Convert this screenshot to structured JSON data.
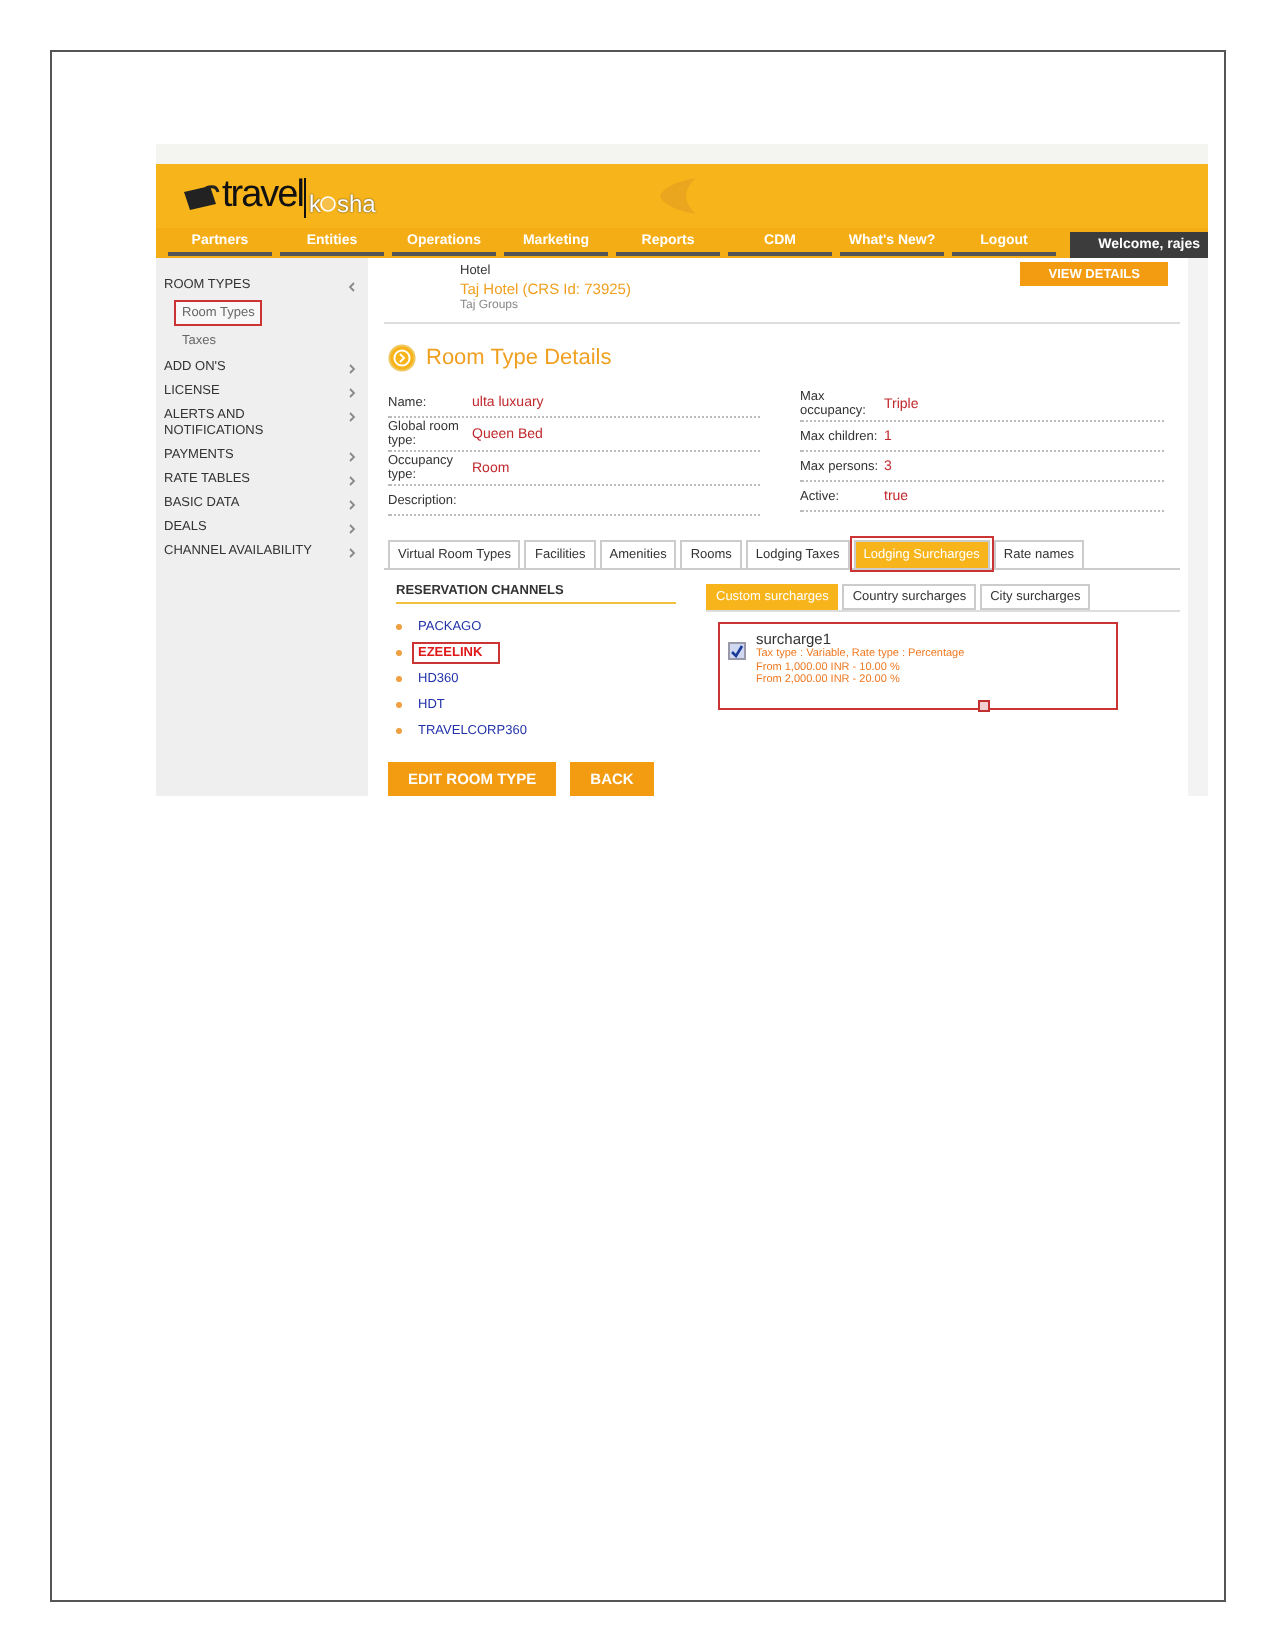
{
  "header": {
    "logo": {
      "first": "travel",
      "second": "k",
      "third": "sha"
    },
    "nav": [
      {
        "label": "Partners"
      },
      {
        "label": "Entities"
      },
      {
        "label": "Operations"
      },
      {
        "label": "Marketing"
      },
      {
        "label": "Reports"
      },
      {
        "label": "CDM"
      },
      {
        "label": "What's New?"
      },
      {
        "label": "Logout"
      }
    ],
    "welcome": "Welcome, rajes"
  },
  "sidebar": {
    "items": [
      {
        "label": "ROOM TYPES",
        "expanded": true,
        "children": [
          {
            "label": "Room Types",
            "selected": true
          },
          {
            "label": "Taxes",
            "selected": false
          }
        ]
      },
      {
        "label": "ADD ON'S",
        "expanded": false
      },
      {
        "label": "LICENSE",
        "expanded": false
      },
      {
        "label": "ALERTS AND NOTIFICATIONS",
        "expanded": false
      },
      {
        "label": "PAYMENTS",
        "expanded": false
      },
      {
        "label": "RATE TABLES",
        "expanded": false
      },
      {
        "label": "BASIC DATA",
        "expanded": false
      },
      {
        "label": "DEALS",
        "expanded": false
      },
      {
        "label": "CHANNEL AVAILABILITY",
        "expanded": false
      }
    ]
  },
  "hotel": {
    "label": "Hotel",
    "name": "Taj Hotel (CRS Id: 73925)",
    "group": "Taj Groups",
    "button": "VIEW DETAILS"
  },
  "details": {
    "title": "Room Type Details",
    "left": [
      {
        "label": "Name:",
        "value": "ulta luxuary"
      },
      {
        "label": "Global room type:",
        "value": "Queen Bed"
      },
      {
        "label": "Occupancy type:",
        "value": "Room"
      },
      {
        "label": "Description:"
      }
    ],
    "right": [
      {
        "label": "Max occupancy:",
        "value": "Triple"
      },
      {
        "label": "Max children:",
        "value": "1"
      },
      {
        "label": "Max persons:",
        "value": "3"
      },
      {
        "label": "Active:",
        "value": "true"
      }
    ]
  },
  "tabs": [
    {
      "label": "Virtual Room Types",
      "selected": false
    },
    {
      "label": "Facilities",
      "selected": false
    },
    {
      "label": "Amenities",
      "selected": false
    },
    {
      "label": "Rooms",
      "selected": false
    },
    {
      "label": "Lodging Taxes",
      "selected": false
    },
    {
      "label": "Lodging Surcharges",
      "selected": true
    },
    {
      "label": "Rate names",
      "selected": false
    }
  ],
  "channels": {
    "title": "RESERVATION CHANNELS",
    "items": [
      {
        "label": "PACKAGO",
        "selected": false
      },
      {
        "label": "EZEELINK",
        "selected": true
      },
      {
        "label": "HD360",
        "selected": false
      },
      {
        "label": "HDT",
        "selected": false
      },
      {
        "label": "TRAVELCORP360",
        "selected": false
      }
    ]
  },
  "surcharge_tabs": [
    {
      "label": "Custom surcharges",
      "selected": true
    },
    {
      "label": "Country surcharges",
      "selected": false
    },
    {
      "label": "City surcharges",
      "selected": false
    }
  ],
  "surcharges": [
    {
      "name": "surcharge1",
      "checked": true,
      "highlighted": true,
      "lines": [
        "Tax type : Variable, Rate type : Percentage",
        "From 1,000.00 INR - 10.00 %",
        "From 2,000.00 INR - 20.00 %"
      ]
    }
  ],
  "buttons": [
    {
      "label": "EDIT ROOM TYPE"
    },
    {
      "label": "BACK"
    }
  ]
}
